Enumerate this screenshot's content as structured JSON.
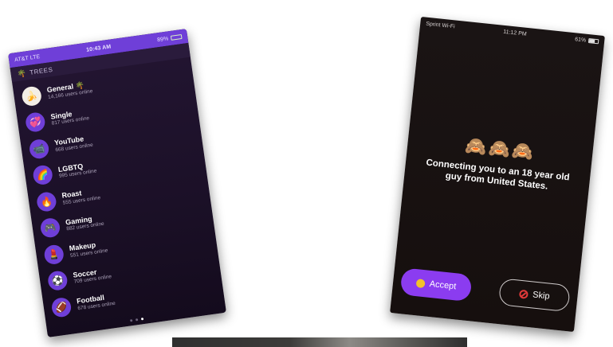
{
  "phone_list": {
    "status": {
      "carrier": "AT&T LTE",
      "time": "10:43 AM",
      "battery": "89%"
    },
    "header": {
      "title": "TREES"
    },
    "items": [
      {
        "name": "General 🌴",
        "count": "14,166 users online",
        "icon": "🍌",
        "style": "white"
      },
      {
        "name": "Single",
        "count": "817 users online",
        "icon": "💞",
        "style": "purple"
      },
      {
        "name": "YouTube",
        "count": "668 users online",
        "icon": "📹",
        "style": "purple"
      },
      {
        "name": "LGBTQ",
        "count": "995 users online",
        "icon": "🌈",
        "style": "purple"
      },
      {
        "name": "Roast",
        "count": "555 users online",
        "icon": "🔥",
        "style": "purple"
      },
      {
        "name": "Gaming",
        "count": "882 users online",
        "icon": "🎮",
        "style": "purple"
      },
      {
        "name": "Makeup",
        "count": "551 users online",
        "icon": "💄",
        "style": "purple"
      },
      {
        "name": "Soccer",
        "count": "709 users online",
        "icon": "⚽",
        "style": "purple"
      },
      {
        "name": "Football",
        "count": "678 users online",
        "icon": "🏈",
        "style": "purple"
      }
    ]
  },
  "phone_connect": {
    "status": {
      "carrier": "Sprint Wi-Fi",
      "time": "11:12 PM",
      "battery": "61%"
    },
    "monkeys": "🙈🙈🙈",
    "message": "Connecting you to an 18 year old guy from United States.",
    "accept_label": "Accept",
    "skip_label": "Skip"
  }
}
